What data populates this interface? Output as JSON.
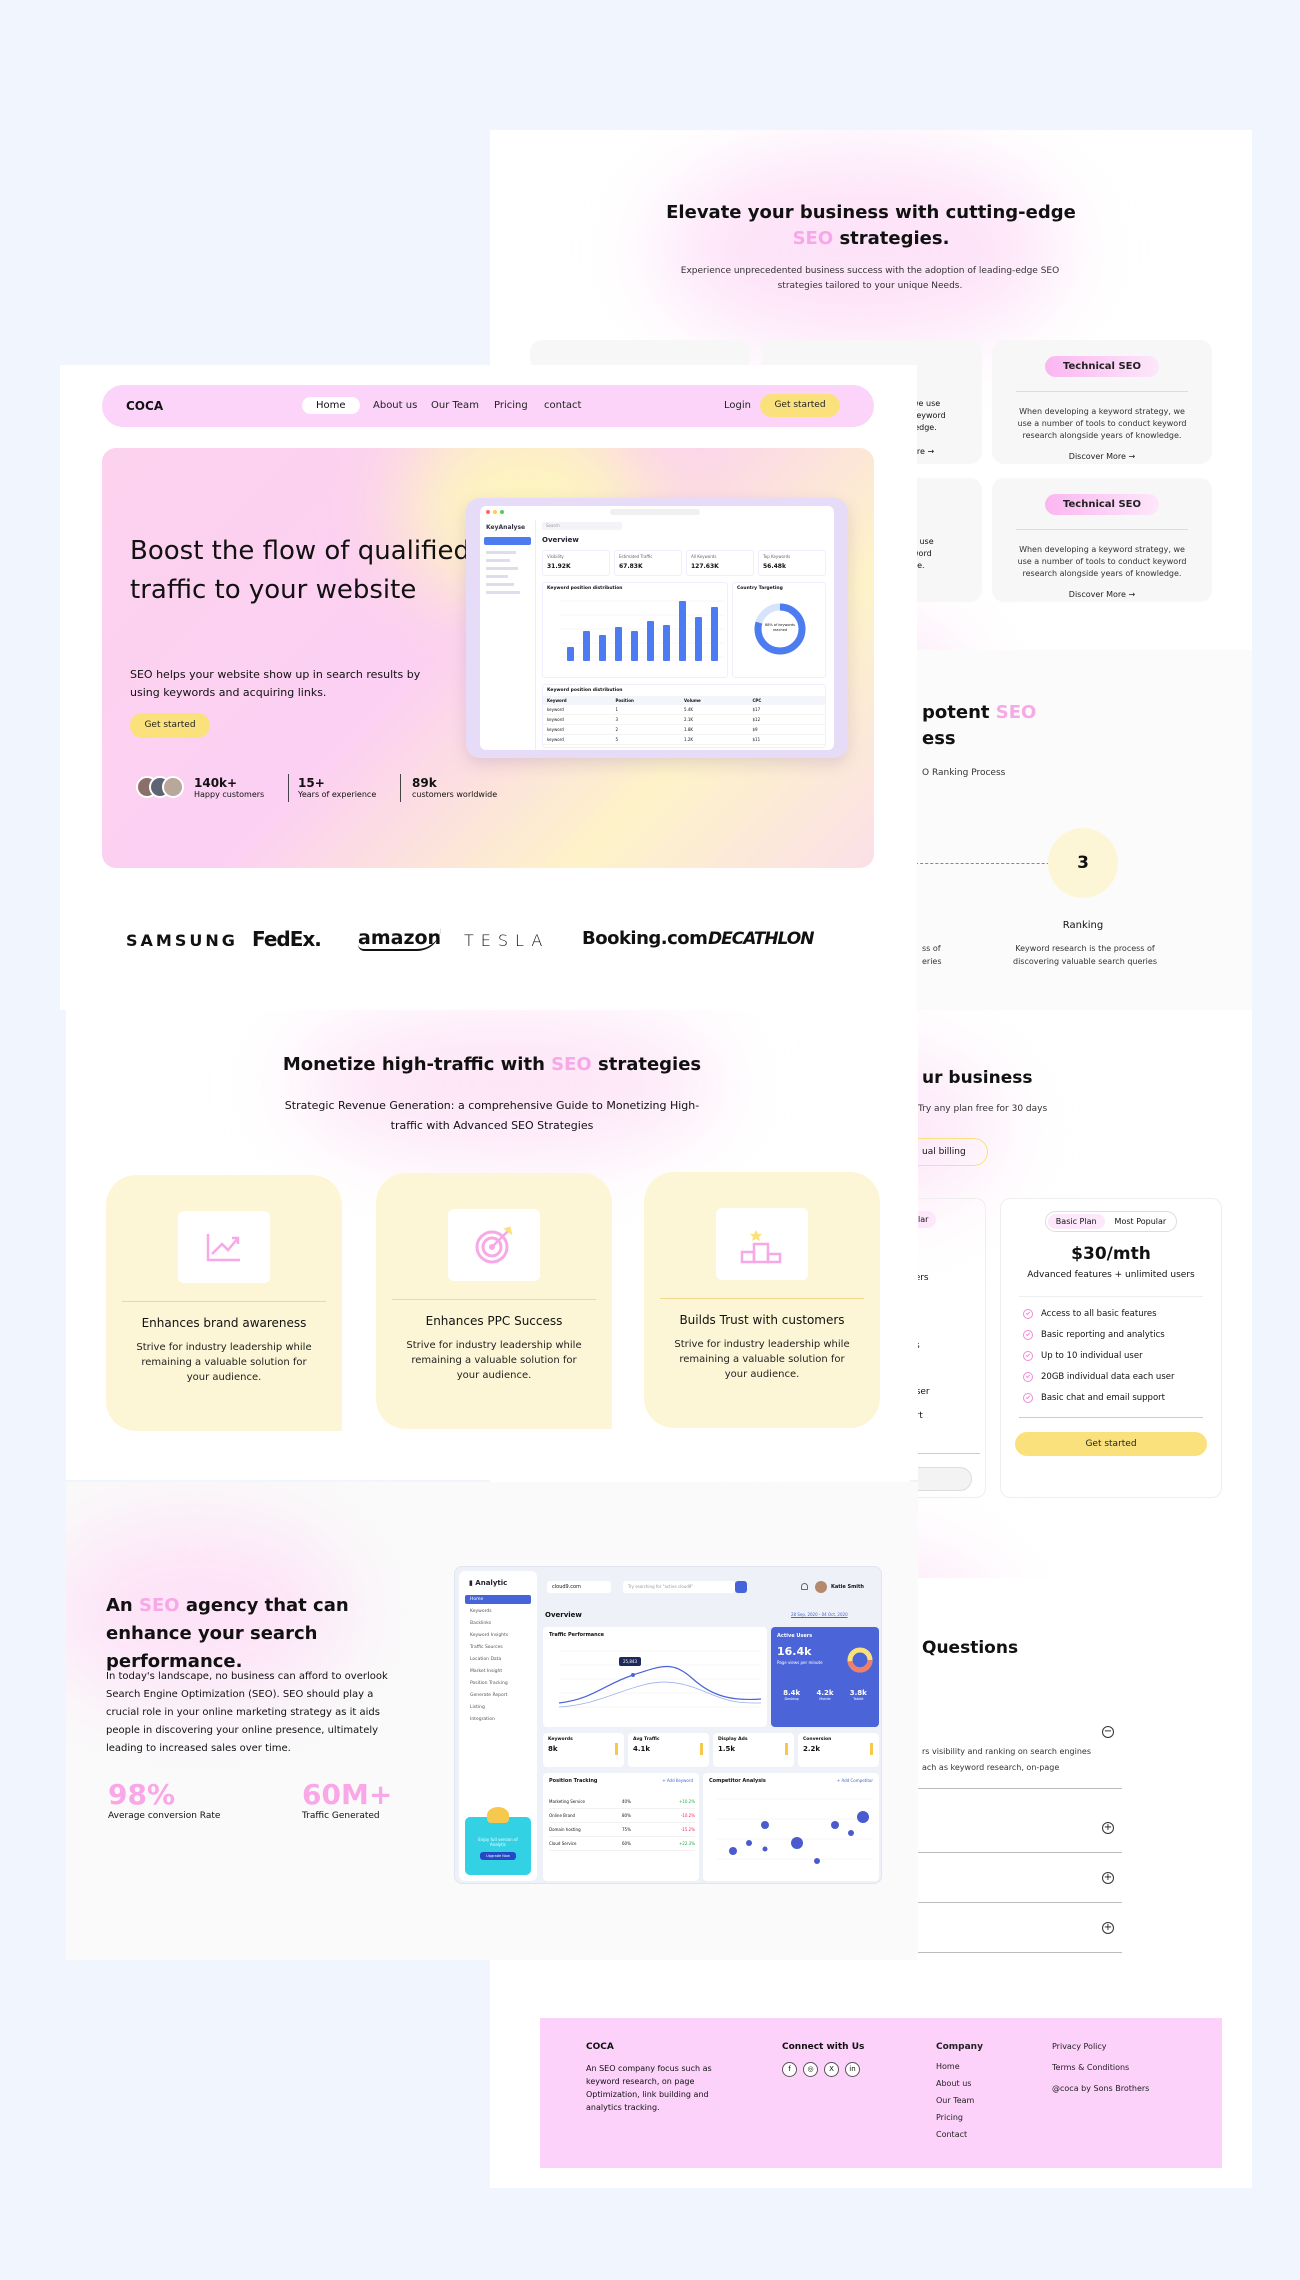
{
  "services": {
    "title_a": "Elevate your business with cutting-edge",
    "title_highlight": "SEO",
    "title_b": "strategies.",
    "subtitle": "Experience unprecedented business success with the adoption of leading-edge SEO strategies tailored to your unique Needs.",
    "cards": [
      {
        "tag": "Technical SEO",
        "text": "When developing a keyword strategy, we use a number of tools to conduct keyword research alongside years of knowledge.",
        "link": "Discover More →"
      },
      {
        "tag": "Technical SEO",
        "text": "When developing a keyword strategy, we use a number of tools to conduct keyword research alongside years of knowledge.",
        "link": "Discover More →"
      }
    ],
    "partial_texts": [
      "we use",
      "keyword",
      "ledge.",
      "ore →"
    ]
  },
  "process": {
    "title_a": "potent",
    "title_highlight": "SEO",
    "title_b": "ess",
    "subtitle": "O Ranking Process",
    "step_number": "3",
    "step_title": "Ranking",
    "step_text": "Keyword research is the process of discovering valuable search queries",
    "left_text": "ess of\nieries"
  },
  "pricing": {
    "title": "ur business",
    "subtitle": "Try any plan free for 30 days",
    "toggle": "ual billing",
    "partial_tag": "lar",
    "partial_lines": [
      "sers",
      "cs",
      "user",
      "ort"
    ],
    "plan_tag": "Basic Plan",
    "plan_badge": "Most Popular",
    "price": "$30/mth",
    "price_desc": "Advanced features + unlimited users",
    "features": [
      "Access to all basic features",
      "Basic reporting and analytics",
      "Up to 10 individual user",
      "20GB individual data each user",
      "Basic chat and email support"
    ],
    "cta": "Get started"
  },
  "faq": {
    "title": "Questions",
    "answer": "rs visibility and ranking on search engines\nach as keyword research, on-page"
  },
  "footer": {
    "brand": "COCA",
    "about": "An SEO company focus such as keyword research, on page Optimization, link building and analytics tracking.",
    "connect_title": "Connect with Us",
    "company_title": "Company",
    "company_links": [
      "Home",
      "About us",
      "Our Team",
      "Pricing",
      "Contact"
    ],
    "legal_links": [
      "Privacy Policy",
      "Terms & Conditions",
      "@coca by Sons Brothers"
    ],
    "social": [
      "f",
      "◎",
      "X",
      "in"
    ]
  },
  "nav": {
    "logo": "COCA",
    "links": [
      "Home",
      "About us",
      "Our Team",
      "Pricing",
      "contact"
    ],
    "login": "Login",
    "cta": "Get started"
  },
  "hero": {
    "title": "Boost the flow of qualified traffic to your website",
    "subtitle": "SEO helps your website show up in search results by using keywords and acquiring links.",
    "cta": "Get started",
    "stats": [
      {
        "value": "140k+",
        "label": "Happy customers"
      },
      {
        "value": "15+",
        "label": "Years of experience"
      },
      {
        "value": "89k",
        "label": "customers worldwide"
      }
    ]
  },
  "hero_dashboard": {
    "brand": "KeyAnalyse",
    "search": "Search",
    "title": "Overview",
    "kpis": [
      {
        "label": "Visibility",
        "value": "31.92K"
      },
      {
        "label": "Estimated Traffic",
        "value": "67.83K"
      },
      {
        "label": "All Keywords",
        "value": "127.63K"
      },
      {
        "label": "Top Keywords",
        "value": "56.48k"
      }
    ],
    "chart_title": "Keyword position distribution",
    "donut_title": "Country Targeting",
    "donut_center": "88% of keywords reached",
    "table_title": "Keyword position distribution",
    "table_headers": [
      "Keyword",
      "Position",
      "Volume",
      "CPC"
    ],
    "table_rows": [
      [
        "keyword",
        "1",
        "5.4K",
        "$17"
      ],
      [
        "keyword",
        "3",
        "2.1K",
        "$12"
      ],
      [
        "keyword",
        "2",
        "1.8K",
        "$9"
      ],
      [
        "keyword",
        "5",
        "1.2K",
        "$11"
      ]
    ]
  },
  "brands": [
    "SAMSUNG",
    "FedEx.",
    "amazon",
    "TESLA",
    "Booking.com",
    "DECATHLON"
  ],
  "monetize": {
    "title_a": "Monetize high-traffic with",
    "title_highlight": "SEO",
    "title_b": "strategies",
    "subtitle": "Strategic Revenue Generation: a comprehensive Guide to Monetizing High-traffic with Advanced SEO Strategies",
    "features": [
      {
        "icon": "trend-up-icon",
        "title": "Enhances brand awareness",
        "text": "Strive for industry leadership while remaining a valuable solution for your audience."
      },
      {
        "icon": "target-icon",
        "title": "Enhances PPC Success",
        "text": "Strive for industry leadership while remaining a valuable solution for your audience."
      },
      {
        "icon": "podium-icon",
        "title": "Builds Trust with customers",
        "text": "Strive for industry leadership while remaining a valuable solution for your audience."
      }
    ]
  },
  "agency": {
    "title_a": "An",
    "title_highlight": "SEO",
    "title_b": "agency that can enhance your search performance.",
    "text": "In today's landscape, no business can afford to overlook Search Engine Optimization (SEO). SEO should play a crucial role in your online marketing strategy as it aids people in discovering your online presence, ultimately leading to increased sales over time.",
    "stats": [
      {
        "value": "98%",
        "label": "Average conversion Rate"
      },
      {
        "value": "60M+",
        "label": "Traffic Generated"
      }
    ]
  },
  "analytic_dashboard": {
    "brand": "Analytic",
    "domain": "cloud9.com",
    "search_placeholder": "Try searching for \"active cloud9\"",
    "user": "Katie Smith",
    "title": "Overview",
    "date_range": "28 Sep, 2020 - 04 Oct, 2020",
    "menu": [
      "Home",
      "Keywords",
      "Backlinks",
      "Keyword Insights",
      "Traffic Sources",
      "Location Data",
      "Market Insight",
      "Position Tracking",
      "Generate Report",
      "Listing",
      "Integration"
    ],
    "traffic_title": "Traffic Performance",
    "tooltip": "25,843",
    "active_users_title": "Active Users",
    "active_users_value": "16.4k",
    "active_users_sub": "Page views per minute",
    "devices": [
      {
        "value": "8.4k",
        "label": "Desktop"
      },
      {
        "value": "4.2k",
        "label": "Mobile"
      },
      {
        "value": "3.8k",
        "label": "Tablet"
      }
    ],
    "kpis": [
      {
        "label": "Keywords",
        "value": "8k"
      },
      {
        "label": "Avg Traffic",
        "value": "4.1k"
      },
      {
        "label": "Display Ads",
        "value": "1.5k"
      },
      {
        "label": "Conversion",
        "value": "2.2k"
      }
    ],
    "position_title": "Position Tracking",
    "position_action": "+ Add Keyword",
    "position_rows": [
      [
        "Marketing Service",
        "40%",
        "+10.2%"
      ],
      [
        "Online Brand",
        "80%",
        "-10.2%"
      ],
      [
        "Domain hosting",
        "75%",
        "-15.2%"
      ],
      [
        "Cloud Service",
        "60%",
        "+22.3%"
      ]
    ],
    "competitor_title": "Competitor Analysis",
    "competitor_action": "+ Add Competitor",
    "upgrade_text": "Enjoy full version of Analytic",
    "upgrade_button": "Upgrade Now"
  }
}
